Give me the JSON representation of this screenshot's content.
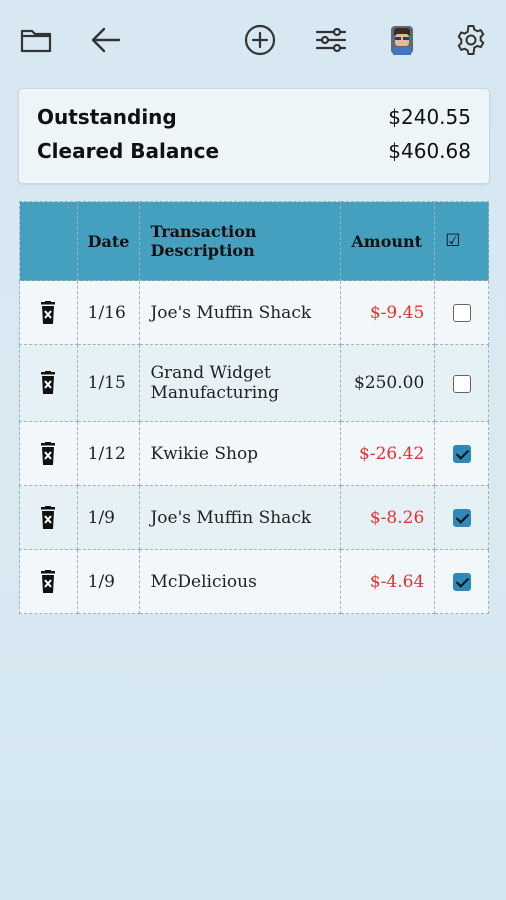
{
  "toolbar": {
    "icons": [
      "folder-icon",
      "back-arrow-icon",
      "add-circle-icon",
      "filter-sliders-icon",
      "profile-avatar",
      "settings-gear-icon"
    ]
  },
  "summary": {
    "outstanding_label": "Outstanding",
    "outstanding_value": "$240.55",
    "cleared_label": "Cleared Balance",
    "cleared_value": "$460.68"
  },
  "table": {
    "headers": {
      "delete": "",
      "date": "Date",
      "description": "Transaction Description",
      "amount": "Amount",
      "check": "☑"
    },
    "rows": [
      {
        "date": "1/16",
        "description": "Joe's Muffin Shack",
        "amount": "$-9.45",
        "cleared": false
      },
      {
        "date": "1/15",
        "description": "Grand Widget Manufacturing",
        "amount": "$250.00",
        "cleared": false
      },
      {
        "date": "1/12",
        "description": "Kwikie Shop",
        "amount": "$-26.42",
        "cleared": true
      },
      {
        "date": "1/9",
        "description": "Joe's Muffin Shack",
        "amount": "$-8.26",
        "cleared": true
      },
      {
        "date": "1/9",
        "description": "McDelicious",
        "amount": "$-4.64",
        "cleared": true
      }
    ]
  },
  "colors": {
    "header_bg": "#45a0c0",
    "negative_amount": "#e53030",
    "checkbox_on": "#2e89b8"
  }
}
